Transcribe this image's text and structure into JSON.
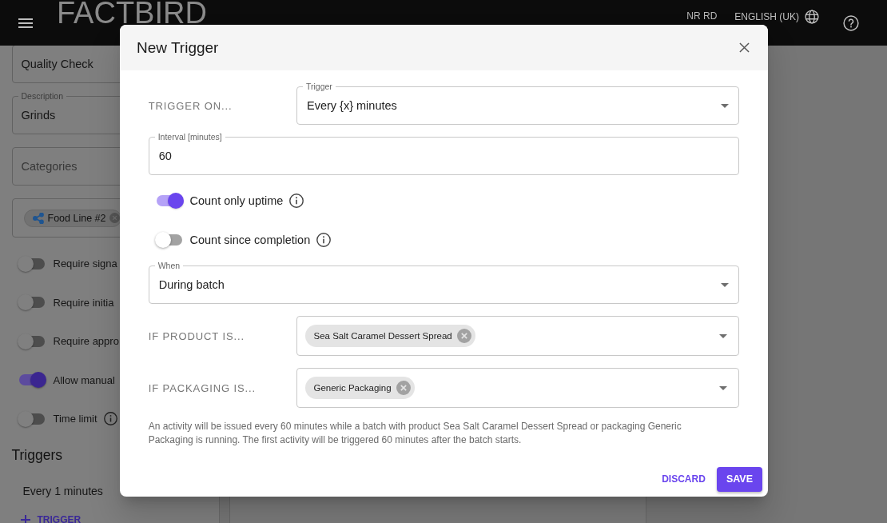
{
  "app_bar": {
    "logo": "FACTBIRD",
    "user": "NR RD",
    "language": "ENGLISH (UK)"
  },
  "activity_form": {
    "fields": [
      {
        "kind": "text",
        "value": "Quality Check"
      },
      {
        "kind": "text",
        "label": "Description",
        "value": "Grinds"
      },
      {
        "kind": "empty",
        "placeholder": "Categories"
      },
      {
        "kind": "chips",
        "chips": [
          {
            "label": "Food Line #2"
          }
        ]
      }
    ],
    "toggles": [
      {
        "label": "Require signa",
        "on": false,
        "info": false
      },
      {
        "label": "Require initia",
        "on": false,
        "info": false
      },
      {
        "label": "Require appro",
        "on": false,
        "info": false
      },
      {
        "label": "Allow manual",
        "on": true,
        "info": false
      },
      {
        "label": "Time limit",
        "on": false,
        "info": true
      }
    ],
    "triggers": {
      "heading": "Triggers",
      "items": [
        "Every 1 minutes"
      ],
      "add_button": "TRIGGER"
    }
  },
  "dialog": {
    "title": "New Trigger",
    "rows": [
      {
        "kind": "labeled_select",
        "label": "TRIGGER ON...",
        "field_label": "Trigger",
        "value": "Every {x} minutes"
      },
      {
        "kind": "input",
        "field_label": "Interval [minutes]",
        "value": "60"
      },
      {
        "kind": "switch",
        "label": "Count only uptime",
        "on": true,
        "info": true
      },
      {
        "kind": "switch",
        "label": "Count since completion",
        "on": false,
        "info": true
      },
      {
        "kind": "select",
        "field_label": "When",
        "value": "During batch"
      },
      {
        "kind": "chip_select",
        "label": "IF PRODUCT IS...",
        "chips": [
          "Sea Salt Caramel Dessert Spread"
        ]
      },
      {
        "kind": "chip_select",
        "label": "IF PACKAGING IS...",
        "chips": [
          "Generic Packaging"
        ]
      }
    ],
    "summary": "An activity will be issued every 60 minutes while a batch with product Sea Salt Caramel Dessert Spread or packaging Generic Packaging is running. The first activity will be triggered 60 minutes after the batch starts.",
    "actions": [
      {
        "kind": "text",
        "label": "DISCARD"
      },
      {
        "kind": "contained",
        "label": "SAVE"
      }
    ]
  }
}
